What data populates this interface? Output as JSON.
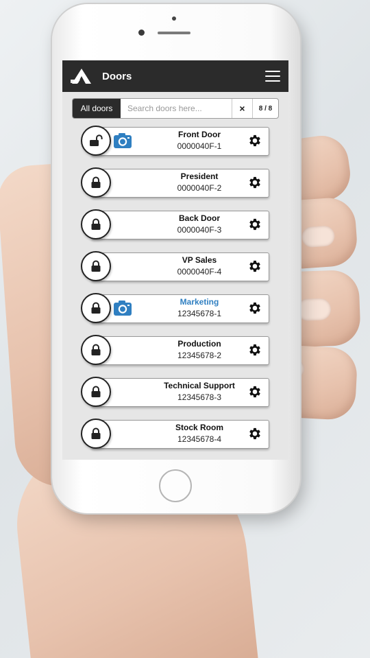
{
  "app": {
    "title": "Doors",
    "accent_color": "#2f7fc1",
    "header_color": "#2b2b2b"
  },
  "search": {
    "filter_label": "All doors",
    "placeholder": "Search doors here...",
    "clear_label": "×",
    "count": "8 / 8"
  },
  "doors": [
    {
      "name": "Front Door",
      "id": "0000040F-1",
      "lock_state": "unlocked",
      "lock_icon": "lock-open-icon",
      "has_camera": true,
      "highlighted": false
    },
    {
      "name": "President",
      "id": "0000040F-2",
      "lock_state": "locked",
      "lock_icon": "lock-icon",
      "has_camera": false,
      "highlighted": false
    },
    {
      "name": "Back Door",
      "id": "0000040F-3",
      "lock_state": "locked",
      "lock_icon": "lock-icon",
      "has_camera": false,
      "highlighted": false
    },
    {
      "name": "VP Sales",
      "id": "0000040F-4",
      "lock_state": "locked",
      "lock_icon": "lock-icon",
      "has_camera": false,
      "highlighted": false
    },
    {
      "name": "Marketing",
      "id": "12345678-1",
      "lock_state": "locked",
      "lock_icon": "lock-icon",
      "has_camera": true,
      "highlighted": true
    },
    {
      "name": "Production",
      "id": "12345678-2",
      "lock_state": "locked",
      "lock_icon": "lock-icon",
      "has_camera": false,
      "highlighted": false
    },
    {
      "name": "Technical Support",
      "id": "12345678-3",
      "lock_state": "locked",
      "lock_icon": "lock-icon",
      "has_camera": false,
      "highlighted": false
    },
    {
      "name": "Stock Room",
      "id": "12345678-4",
      "lock_state": "locked",
      "lock_icon": "lock-icon",
      "has_camera": false,
      "highlighted": false
    }
  ]
}
